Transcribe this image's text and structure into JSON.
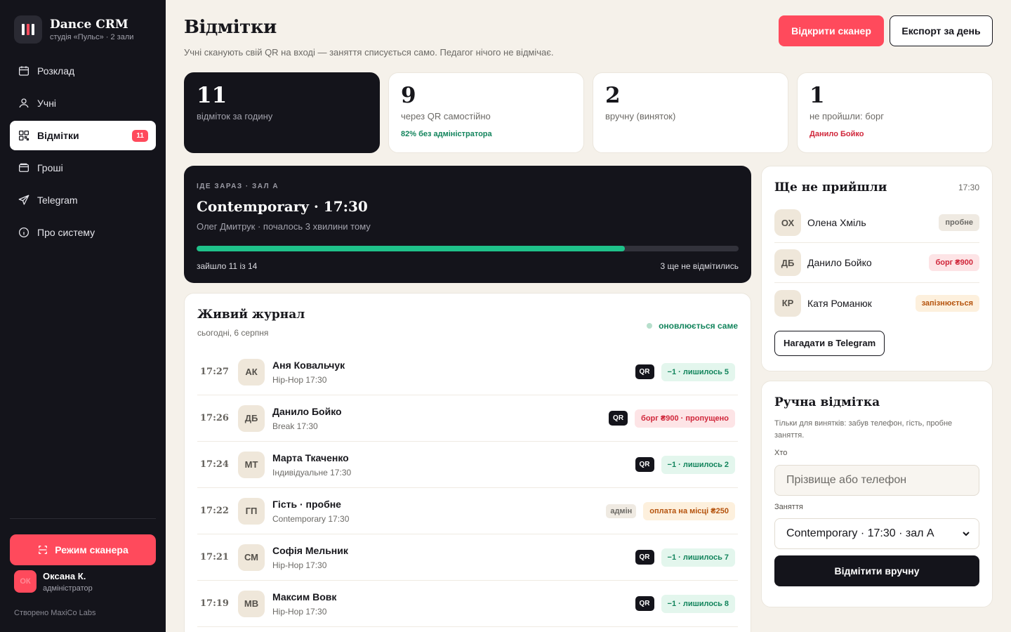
{
  "sidebar": {
    "brand_title": "Dance CRM",
    "brand_sub": "студія «Пульс» · 2 зали",
    "nav": [
      {
        "label": "Розклад",
        "icon": "calendar-icon"
      },
      {
        "label": "Учні",
        "icon": "user-icon"
      },
      {
        "label": "Відмітки",
        "icon": "qr-icon",
        "badge": "11"
      },
      {
        "label": "Гроші",
        "icon": "wallet-icon"
      },
      {
        "label": "Telegram",
        "icon": "send-icon"
      },
      {
        "label": "Про систему",
        "icon": "info-icon"
      }
    ],
    "scanner_button": "Режим сканера",
    "user_initials": "ОК",
    "user_name": "Оксана К.",
    "user_role": "адміністратор",
    "credit": "Створено MaxiCo Labs"
  },
  "header": {
    "title": "Відмітки",
    "subtitle": "Учні сканують свій QR на вході — заняття списується само. Педагог нічого не відмічає.",
    "scan_button": "Відкрити сканер",
    "export_button": "Експорт за день"
  },
  "stats": [
    {
      "value": "11",
      "label": "відміток за годину",
      "note": ""
    },
    {
      "value": "9",
      "label": "через QR самостійно",
      "note": "82% без адміністратора"
    },
    {
      "value": "2",
      "label": "вручну (виняток)",
      "note": ""
    },
    {
      "value": "1",
      "label": "не пройшли: борг",
      "note": "Данило Бойко"
    }
  ],
  "now": {
    "kicker": "ІДЕ ЗАРАЗ · ЗАЛ А",
    "title": "Contemporary · 17:30",
    "subtitle": "Олег Дмитрук · почалось 3 хвилини тому",
    "progress_fraction": 0.79,
    "entered": "зайшло 11 із 14",
    "remaining": "3 ще не відмітились"
  },
  "journal": {
    "title": "Живий журнал",
    "date": "сьогодні, 6 серпня",
    "live_label": "оновлюється саме",
    "rows": [
      {
        "time": "17:27",
        "initials": "АК",
        "name": "Аня Ковальчук",
        "class": "Hip-Hop 17:30",
        "source": "QR",
        "status": "−1 · лишилось 5",
        "tone": "green"
      },
      {
        "time": "17:26",
        "initials": "ДБ",
        "name": "Данило Бойко",
        "class": "Break 17:30",
        "source": "QR",
        "status": "борг ₴900 · пропущено",
        "tone": "red"
      },
      {
        "time": "17:24",
        "initials": "МТ",
        "name": "Марта Ткаченко",
        "class": "Індивідуальне 17:30",
        "source": "QR",
        "status": "−1 · лишилось 2",
        "tone": "green"
      },
      {
        "time": "17:22",
        "initials": "ГП",
        "name": "Гість · пробне",
        "class": "Contemporary 17:30",
        "source": "адмін",
        "status": "оплата на місці ₴250",
        "tone": "amber"
      },
      {
        "time": "17:21",
        "initials": "СМ",
        "name": "Софія Мельник",
        "class": "Hip-Hop 17:30",
        "source": "QR",
        "status": "−1 · лишилось 7",
        "tone": "green"
      },
      {
        "time": "17:19",
        "initials": "МВ",
        "name": "Максим Вовк",
        "class": "Hip-Hop 17:30",
        "source": "QR",
        "status": "−1 · лишилось 8",
        "tone": "green"
      }
    ]
  },
  "absent": {
    "title": "Ще не прийшли",
    "time": "17:30",
    "rows": [
      {
        "initials": "ОХ",
        "name": "Олена Хміль",
        "tag": "пробне",
        "tone": "neutral"
      },
      {
        "initials": "ДБ",
        "name": "Данило Бойко",
        "tag": "борг ₴900",
        "tone": "red"
      },
      {
        "initials": "КР",
        "name": "Катя Романюк",
        "tag": "запізнюється",
        "tone": "amber"
      }
    ],
    "remind_button": "Нагадати в Telegram"
  },
  "manual": {
    "title": "Ручна відмітка",
    "description": "Тільки для винятків: забув телефон, гість, пробне заняття.",
    "who_label": "Хто",
    "who_placeholder": "Прізвище або телефон",
    "class_label": "Заняття",
    "class_value": "Contemporary · 17:30 · зал А",
    "submit_button": "Відмітити вручну"
  },
  "colors": {
    "accent": "#ff4a5c",
    "dark": "#14141b",
    "success": "#12845c",
    "danger": "#d0263a",
    "warning": "#b5530d",
    "background": "#f5f1ea"
  }
}
